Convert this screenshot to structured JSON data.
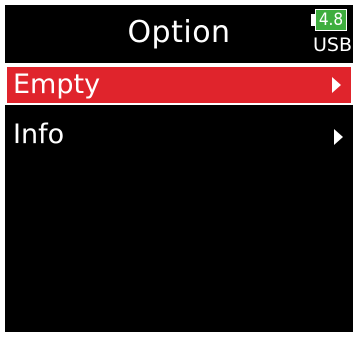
{
  "header": {
    "title": "Option",
    "battery_level": "4.8",
    "power_source": "USB"
  },
  "menu": {
    "items": [
      {
        "label": "Empty",
        "selected": true,
        "icon": "arrow-right-icon"
      },
      {
        "label": "Info",
        "selected": false,
        "icon": "arrow-right-icon"
      }
    ]
  },
  "colors": {
    "background": "#000000",
    "selected_highlight": "#e0242c",
    "battery": "#3fae3f",
    "text": "#ffffff"
  }
}
